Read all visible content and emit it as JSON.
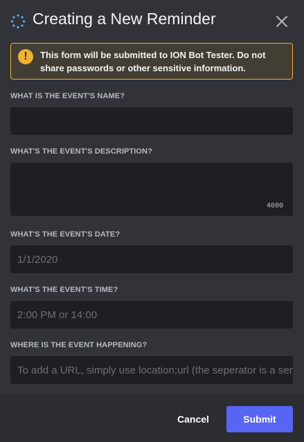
{
  "modal": {
    "title": "Creating a New Reminder",
    "header_icon": "loading-ring-icon",
    "close_icon": "close-icon"
  },
  "warning": {
    "icon": "exclamation-icon",
    "text_prefix": "This form will be submitted to ",
    "bot_name": "ION Bot Tester",
    "text_suffix": ". Do not share passwords or other sensitive information.",
    "color": "#f0b232"
  },
  "fields": {
    "name": {
      "label": "WHAT IS THE EVENT'S NAME?",
      "placeholder": "",
      "value": ""
    },
    "description": {
      "label": "WHAT'S THE EVENT'S DESCRIPTION?",
      "value": "",
      "counter": "4000"
    },
    "date": {
      "label": "WHAT'S THE EVENT'S DATE?",
      "placeholder": "1/1/2020"
    },
    "time": {
      "label": "WHAT'S THE EVENT'S TIME?",
      "placeholder": "2:00 PM or 14:00"
    },
    "location": {
      "label": "WHERE IS THE EVENT HAPPENING?",
      "placeholder": "To add a URL, simply use location;url (the seperator is a semicolon)"
    }
  },
  "footer": {
    "cancel_label": "Cancel",
    "submit_label": "Submit",
    "accent": "#5865f2"
  }
}
